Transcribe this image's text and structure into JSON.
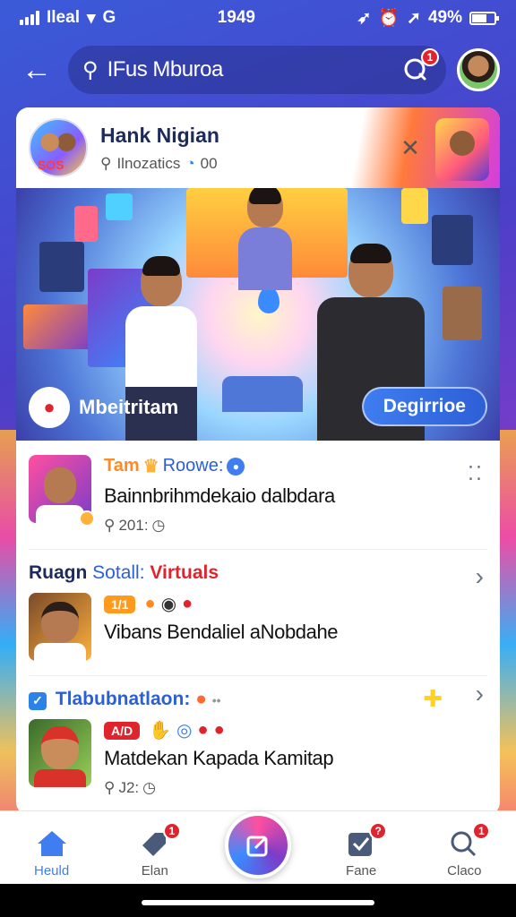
{
  "status_bar": {
    "carrier": "Ileal",
    "time": "1949",
    "battery_percent": "49%"
  },
  "top_bar": {
    "search_text": "IFus Mburoa",
    "chat_badge": "1"
  },
  "group": {
    "title": "Hank Nigian",
    "subtitle": "Ilnozatics",
    "subtitle_count": "00",
    "avatar_badge": "SOS"
  },
  "hero": {
    "left_label": "Mbeitritam",
    "cta_label": "Degirrioe"
  },
  "feed": {
    "item1": {
      "title": "Tam",
      "title_accent": "Roowe:",
      "text": "Bainnbrihmdekaio dalbdara",
      "meta": "201:"
    },
    "section": {
      "part1": "Ruagn",
      "part2": "Sotall:",
      "part3": "Virtuals"
    },
    "item2": {
      "tag": "1/1",
      "text": "Vibans Bendaliel aNobdahe"
    },
    "section2": {
      "title": "Tlabubnatlaon:"
    },
    "item3": {
      "tag": "A/D",
      "text": "Matdekan Kapada Kamitap",
      "meta": "J2:"
    }
  },
  "bottom_nav": {
    "home_label": "Heuld",
    "tab2_label": "Elan",
    "tab2_badge": "1",
    "tab4_label": "Fane",
    "tab4_badge": "?",
    "tab5_label": "Claco",
    "tab5_badge": "1"
  },
  "colors": {
    "accent": "#3f7df0",
    "title": "#1d2a5c",
    "badge": "#e0242e"
  }
}
